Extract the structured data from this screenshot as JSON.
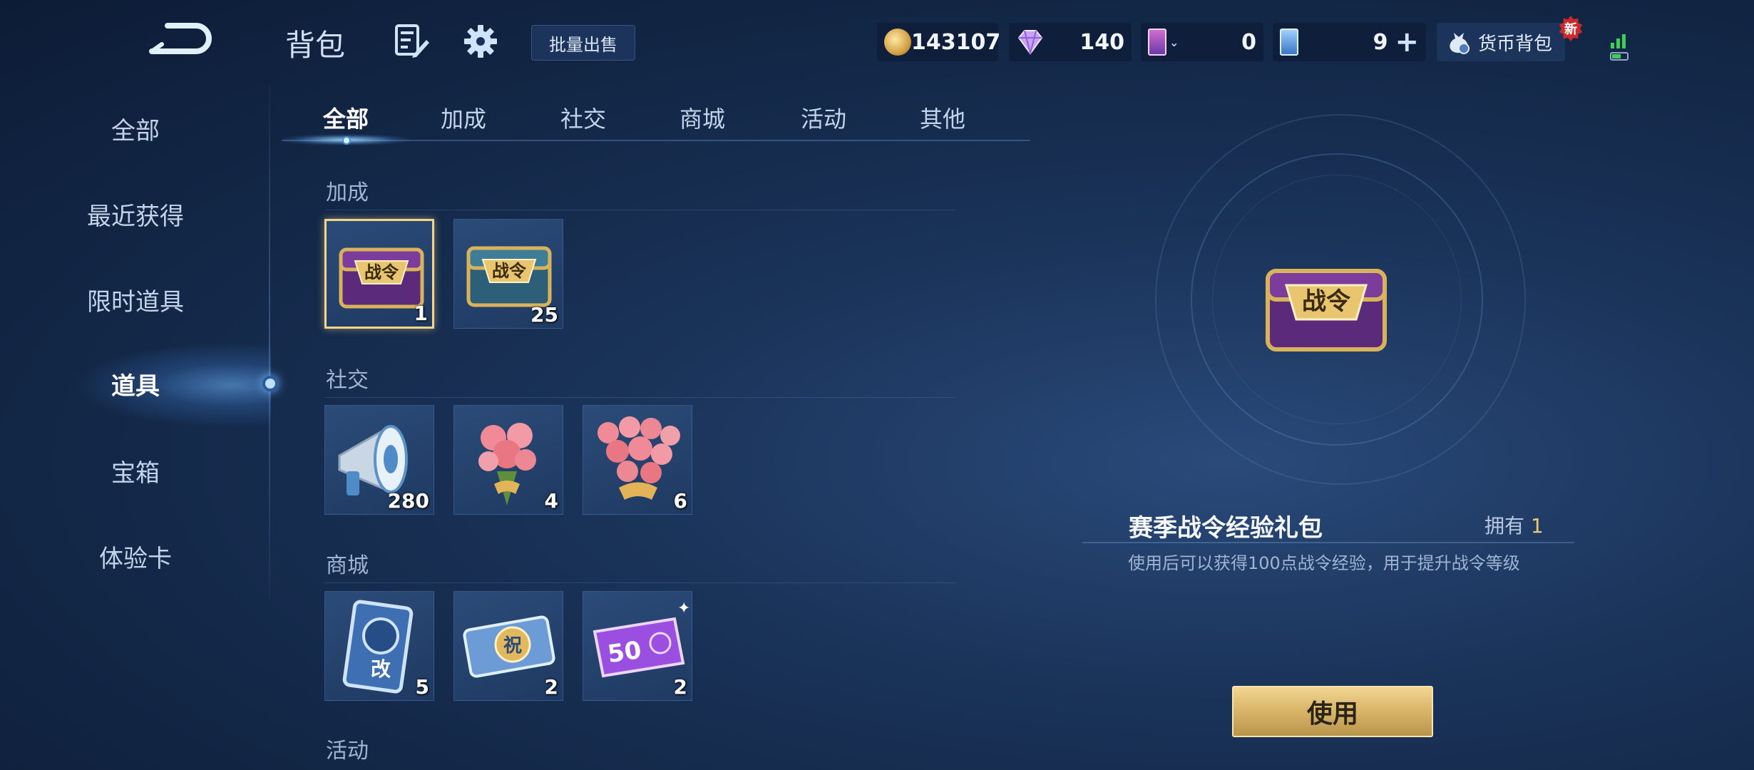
{
  "header": {
    "title": "背包",
    "bulk_sell_label": "批量出售",
    "currency_bag_label": "货币背包",
    "new_badge": "新"
  },
  "currencies": [
    {
      "icon": "gold-coin-icon",
      "value": "143107"
    },
    {
      "icon": "diamond-icon",
      "value": "140"
    },
    {
      "icon": "card-coupon-icon",
      "value": "0"
    },
    {
      "icon": "ticket-icon",
      "value": "9"
    }
  ],
  "sidebar": {
    "items": [
      {
        "label": "全部"
      },
      {
        "label": "最近获得"
      },
      {
        "label": "限时道具"
      },
      {
        "label": "道具"
      },
      {
        "label": "宝箱"
      },
      {
        "label": "体验卡"
      }
    ],
    "active_index": 3
  },
  "tabs": [
    {
      "label": "全部"
    },
    {
      "label": "加成"
    },
    {
      "label": "社交"
    },
    {
      "label": "商城"
    },
    {
      "label": "活动"
    },
    {
      "label": "其他"
    }
  ],
  "sections": [
    {
      "title": "加成",
      "items": [
        {
          "icon": "battle-pass-chest-icon",
          "count": "1",
          "selected": true
        },
        {
          "icon": "battle-pass-blue-chest-icon",
          "count": "25"
        }
      ]
    },
    {
      "title": "社交",
      "items": [
        {
          "icon": "megaphone-icon",
          "count": "280"
        },
        {
          "icon": "rose-bouquet-small-icon",
          "count": "4"
        },
        {
          "icon": "rose-bouquet-large-icon",
          "count": "6"
        }
      ]
    },
    {
      "title": "商城",
      "items": [
        {
          "icon": "rename-card-icon",
          "count": "5"
        },
        {
          "icon": "blue-ticket-icon",
          "count": "2"
        },
        {
          "icon": "purple-coupon-icon",
          "count": "2"
        }
      ]
    },
    {
      "title": "活动",
      "items": []
    }
  ],
  "item_labels": {
    "chest_label": "战令",
    "rename_label": "改",
    "ticket_label": "祝",
    "coupon_label": "50"
  },
  "detail": {
    "name": "赛季战令经验礼包",
    "own_label": "拥有",
    "own_count": "1",
    "description": "使用后可以获得100点战令经验，用于提升战令等级",
    "use_label": "使用"
  },
  "colors": {
    "accent_gold": "#f3d489",
    "own_count": "#f0c870",
    "new_badge": "#c92a2a"
  }
}
